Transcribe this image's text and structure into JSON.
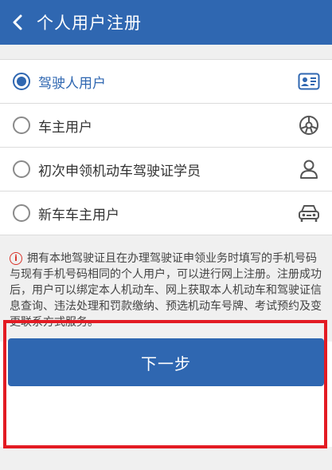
{
  "header": {
    "back_icon": "chevron-left-icon",
    "title": "个人用户注册"
  },
  "options": [
    {
      "label": "驾驶人用户",
      "selected": true,
      "icon": "id-card-icon"
    },
    {
      "label": "车主用户",
      "selected": false,
      "icon": "steering-wheel-icon"
    },
    {
      "label": "初次申领机动车驾驶证学员",
      "selected": false,
      "icon": "person-icon"
    },
    {
      "label": "新车车主用户",
      "selected": false,
      "icon": "car-front-icon"
    }
  ],
  "notice": {
    "icon": "info-icon",
    "text": "拥有本地驾驶证且在办理驾驶证申领业务时填写的手机号码与现有手机号码相同的个人用户，可以进行网上注册。注册成功后，用户可以绑定本人机动车、网上获取本人机动车和驾驶证信息查询、违法处理和罚款缴纳、预选机动车号牌、考试预约及变更联系方式服务。"
  },
  "next_button": {
    "label": "下一步"
  },
  "colors": {
    "primary": "#2f67b1",
    "highlight": "#e31b23",
    "notice_icon": "#d9332a"
  }
}
